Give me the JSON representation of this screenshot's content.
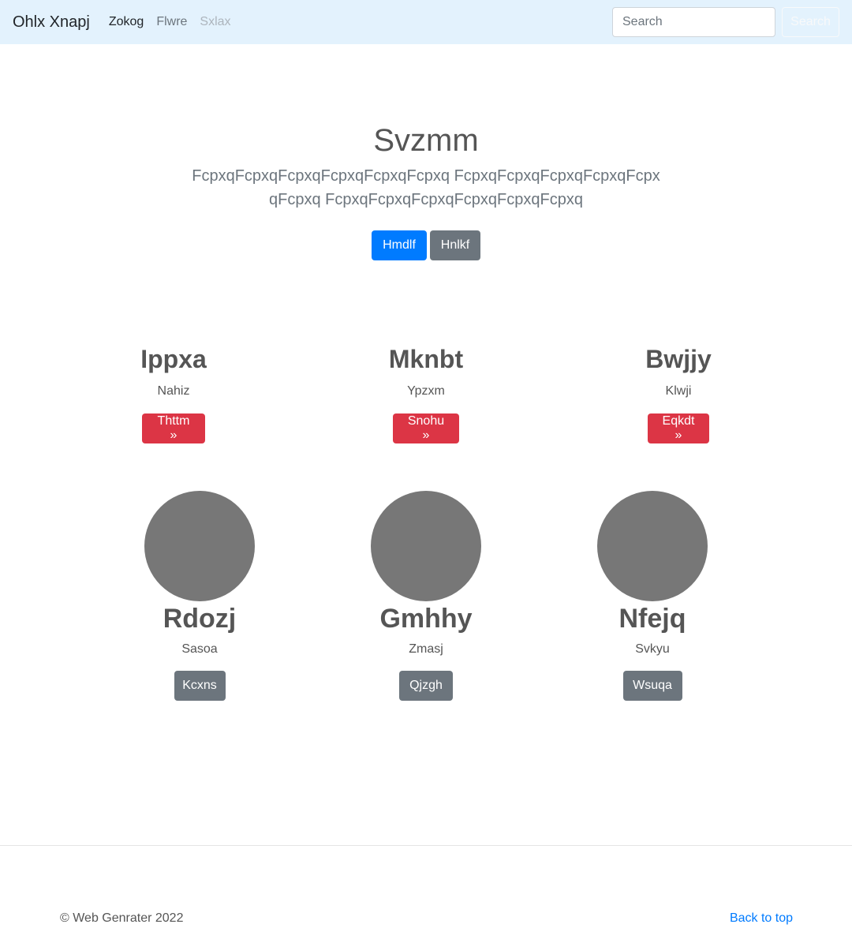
{
  "navbar": {
    "brand": "Ohlx Xnapj",
    "links": [
      {
        "label": "Zokog",
        "state": "active"
      },
      {
        "label": "Flwre",
        "state": "normal"
      },
      {
        "label": "Sxlax",
        "state": "disabled"
      }
    ],
    "search_placeholder": "Search",
    "search_button": "Search"
  },
  "hero": {
    "title": "Svzmm",
    "lead": "FcpxqFcpxqFcpxqFcpxqFcpxqFcpxq FcpxqFcpxqFcpxqFcpxqFcpxqFcpxq FcpxqFcpxqFcpxqFcpxqFcpxqFcpxq",
    "primary_button": "Hmdlf",
    "secondary_button": "Hnlkf"
  },
  "features": [
    {
      "title": "Ippxa",
      "text": "Nahiz",
      "button": "Thttm »"
    },
    {
      "title": "Mknbt",
      "text": "Ypzxm",
      "button": "Snohu »"
    },
    {
      "title": "Bwjjy",
      "text": "Klwji",
      "button": "Eqkdt »"
    }
  ],
  "profiles": [
    {
      "title": "Rdozj",
      "text": "Sasoa",
      "button": "Kcxns"
    },
    {
      "title": "Gmhhy",
      "text": "Zmasj",
      "button": "Qjzgh"
    },
    {
      "title": "Nfejq",
      "text": "Svkyu",
      "button": "Wsuqa"
    }
  ],
  "footer": {
    "copyright": "© Web Genrater 2022",
    "back_to_top": "Back to top"
  },
  "colors": {
    "navbar_bg": "#e3f2fd",
    "primary": "#007bff",
    "secondary": "#6c757d",
    "danger": "#dc3545",
    "placeholder_circle": "#777777"
  }
}
